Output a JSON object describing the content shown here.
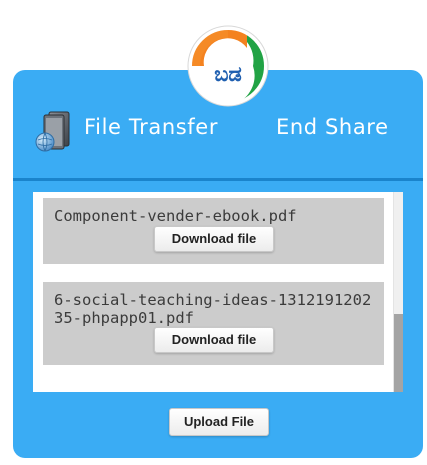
{
  "header": {
    "app_title": "File Transfer",
    "end_share_label": "End Share",
    "logo_text": "ಬಡ",
    "logo_colors": {
      "saffron": "#f4821f",
      "white": "#ffffff",
      "green": "#22a345",
      "ring": "#1f5fb0"
    },
    "app_icon": "file-transfer-icon"
  },
  "files": [
    {
      "name": "Component-vender-ebook.pdf",
      "download_label": "Download file"
    },
    {
      "name": "6-social-teaching-ideas-131219120235-phpapp01.pdf",
      "download_label": "Download file"
    }
  ],
  "upload_label": "Upload File",
  "colors": {
    "panel": "#3aacf4",
    "divider": "#1a84cc",
    "file_item": "#cccccc"
  }
}
